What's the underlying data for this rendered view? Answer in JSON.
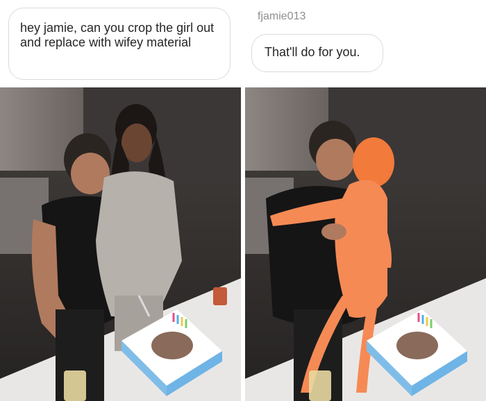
{
  "request_message": {
    "text": "hey jamie, can you crop the girl out and replace with wifey material"
  },
  "reply": {
    "username": "fjamie013",
    "text": "That'll do for you."
  },
  "photos": {
    "original": {
      "description_icon": "photo-icon"
    },
    "edited": {
      "description_icon": "photo-icon"
    }
  },
  "colors": {
    "bubble_border": "#dbdbdb",
    "text": "#262626",
    "username": "#8e8e8e",
    "cake_frosting": "#6fb4e6",
    "doll": "#f58a55"
  }
}
